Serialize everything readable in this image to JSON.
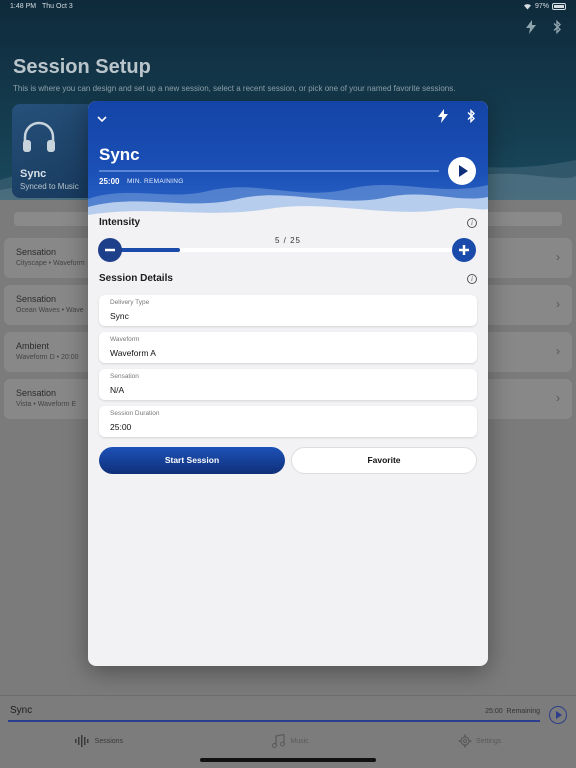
{
  "status": {
    "time": "1:48 PM",
    "date": "Thu Oct 3",
    "battery": "97%"
  },
  "background": {
    "title": "Session Setup",
    "subtitle": "This is where you can design and set up a new session, select a recent session, or pick one of your named favorite sessions.",
    "card": {
      "title": "Sync",
      "subtitle": "Synced to Music"
    },
    "list": [
      {
        "name": "Sensation",
        "detail": "Cityscape • Waveform"
      },
      {
        "name": "Sensation",
        "detail": "Ocean Waves • Wave"
      },
      {
        "name": "Ambient",
        "detail": "Waveform D • 20:00"
      },
      {
        "name": "Sensation",
        "detail": "Vista • Waveform E"
      }
    ]
  },
  "now_playing": {
    "title": "Sync",
    "time": "25:00",
    "time_label": "Remaining"
  },
  "tabs": [
    {
      "label": "Sessions",
      "icon": "waveform-icon"
    },
    {
      "label": "Music",
      "icon": "music-note-icon"
    },
    {
      "label": "Settings",
      "icon": "gear-icon"
    }
  ],
  "modal": {
    "title": "Sync",
    "time": "25:00",
    "time_label": "MIN. REMAINING",
    "intensity": {
      "label": "Intensity",
      "value": 5,
      "max": 25,
      "display": "5 / 25"
    },
    "details_label": "Session Details",
    "fields": [
      {
        "label": "Delivery Type",
        "value": "Sync"
      },
      {
        "label": "Waveform",
        "value": "Waveform A"
      },
      {
        "label": "Sensation",
        "value": "N/A"
      },
      {
        "label": "Session Duration",
        "value": "25:00"
      }
    ],
    "start_label": "Start Session",
    "favorite_label": "Favorite"
  },
  "colors": {
    "accent": "#1a4aaa",
    "header": "#1444a6"
  }
}
